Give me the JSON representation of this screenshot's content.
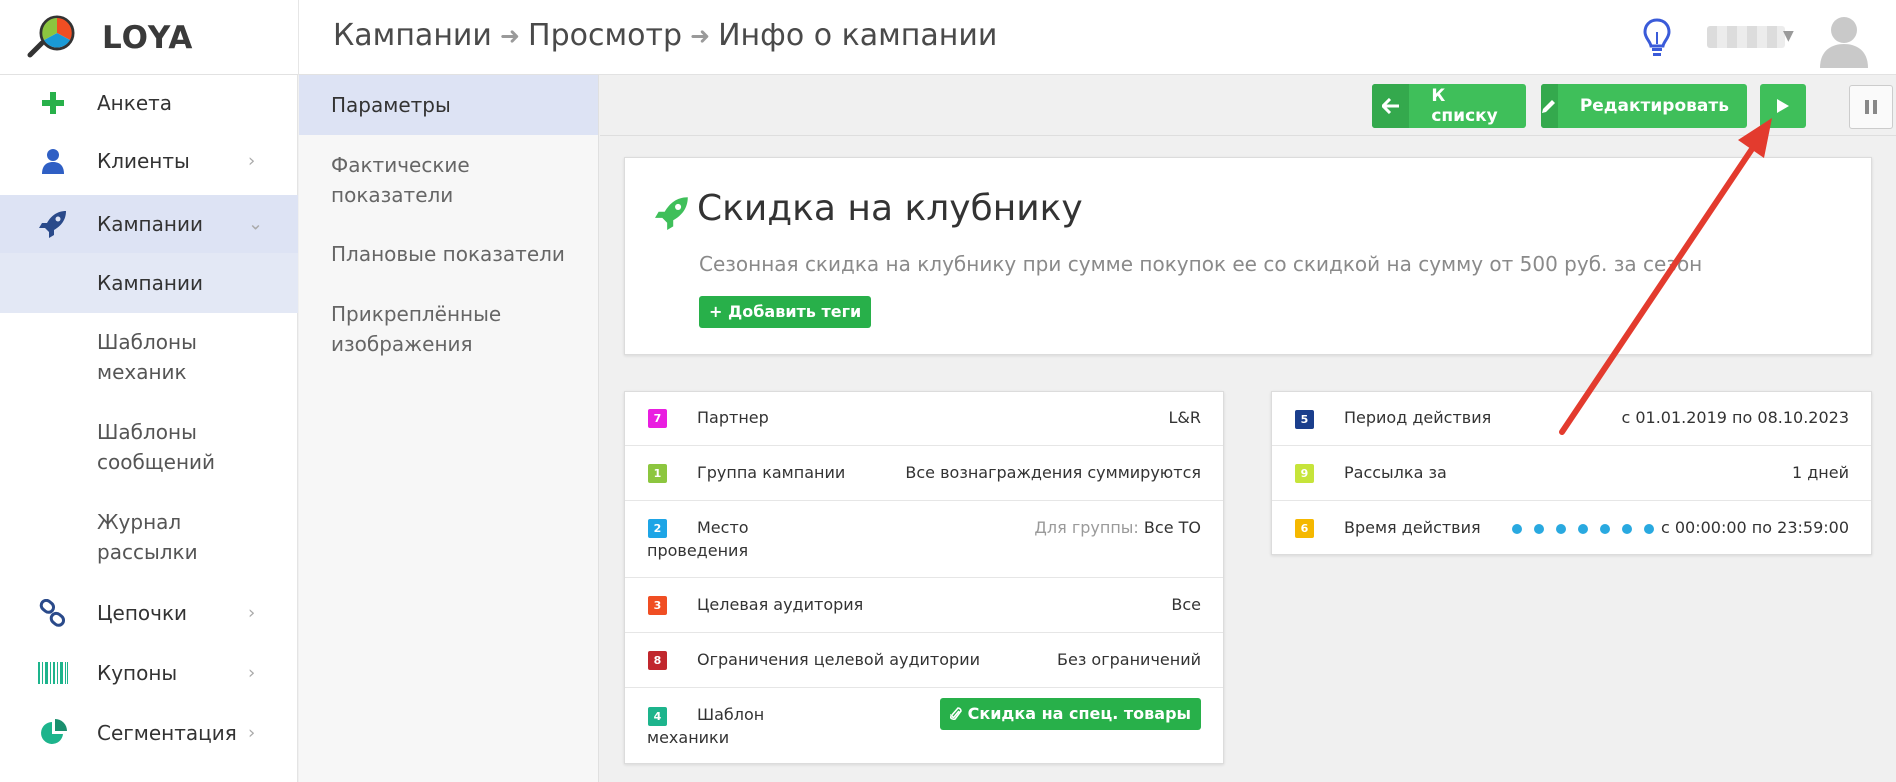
{
  "app": {
    "name": "LOYA"
  },
  "breadcrumb": [
    "Кампании",
    "Просмотр",
    "Инфо о кампании"
  ],
  "sidebar": {
    "items": [
      {
        "label": "Анкета",
        "icon": "plus-icon"
      },
      {
        "label": "Клиенты",
        "icon": "user-icon"
      },
      {
        "label": "Кампании",
        "icon": "rocket-icon"
      },
      {
        "label": "Кампании"
      },
      {
        "label": "Шаблоны механик"
      },
      {
        "label": "Шаблоны сообщений"
      },
      {
        "label": "Журнал рассылки"
      },
      {
        "label": "Цепочки",
        "icon": "chain-icon"
      },
      {
        "label": "Купоны",
        "icon": "barcode-icon"
      },
      {
        "label": "Сегментация",
        "icon": "pie-icon"
      }
    ]
  },
  "subnav": {
    "items": [
      "Параметры",
      "Фактические показатели",
      "Плановые показатели",
      "Прикреплённые изображения"
    ]
  },
  "toolbar": {
    "back_label": "К списку",
    "edit_label": "Редактировать"
  },
  "campaign": {
    "title": "Скидка на клубнику",
    "description": "Сезонная скидка на клубнику при сумме покупок ее со скидкой на сумму от 500 руб. за сезон",
    "add_tags_label": "+ Добавить теги"
  },
  "params_left": [
    {
      "num": "7",
      "color": "#e91ee0",
      "label": "Партнер",
      "value": "L&R"
    },
    {
      "num": "1",
      "color": "#8cc63f",
      "label": "Группа кампании",
      "value": "Все вознаграждения суммируются"
    },
    {
      "num": "2",
      "color": "#1ea5e6",
      "label": "Место",
      "label2": "проведения",
      "value_prefix": "Для группы:",
      "value": "Все ТО"
    },
    {
      "num": "3",
      "color": "#f04e23",
      "label": "Целевая аудитория",
      "value": "Все"
    },
    {
      "num": "8",
      "color": "#c1272d",
      "label": "Ограничения целевой аудитории",
      "value": "Без ограничений"
    },
    {
      "num": "4",
      "color": "#1db48c",
      "label": "Шаблон",
      "label2": "механики",
      "value": "Скидка на спец. товары"
    }
  ],
  "params_right": [
    {
      "num": "5",
      "color": "#1a3e8c",
      "label": "Период действия",
      "value": "с 01.01.2019 по 08.10.2023"
    },
    {
      "num": "9",
      "color": "#c6e43a",
      "label": "Рассылка за",
      "value": "1 дней"
    },
    {
      "num": "6",
      "color": "#f5b800",
      "label": "Время действия",
      "value": "с 00:00:00 по 23:59:00"
    }
  ]
}
